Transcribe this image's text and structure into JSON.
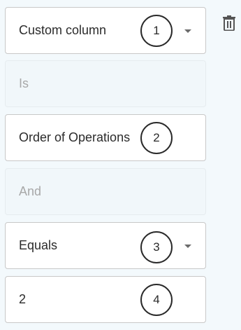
{
  "filter": {
    "column_label": "Custom column",
    "is_label": "Is",
    "custom_value": "Order of Operations",
    "and_label": "And",
    "operator_label": "Equals",
    "value": "2"
  },
  "badges": [
    "1",
    "2",
    "3",
    "4"
  ],
  "icons": {
    "delete": "trash-icon",
    "dropdown": "chevron-down-icon"
  }
}
